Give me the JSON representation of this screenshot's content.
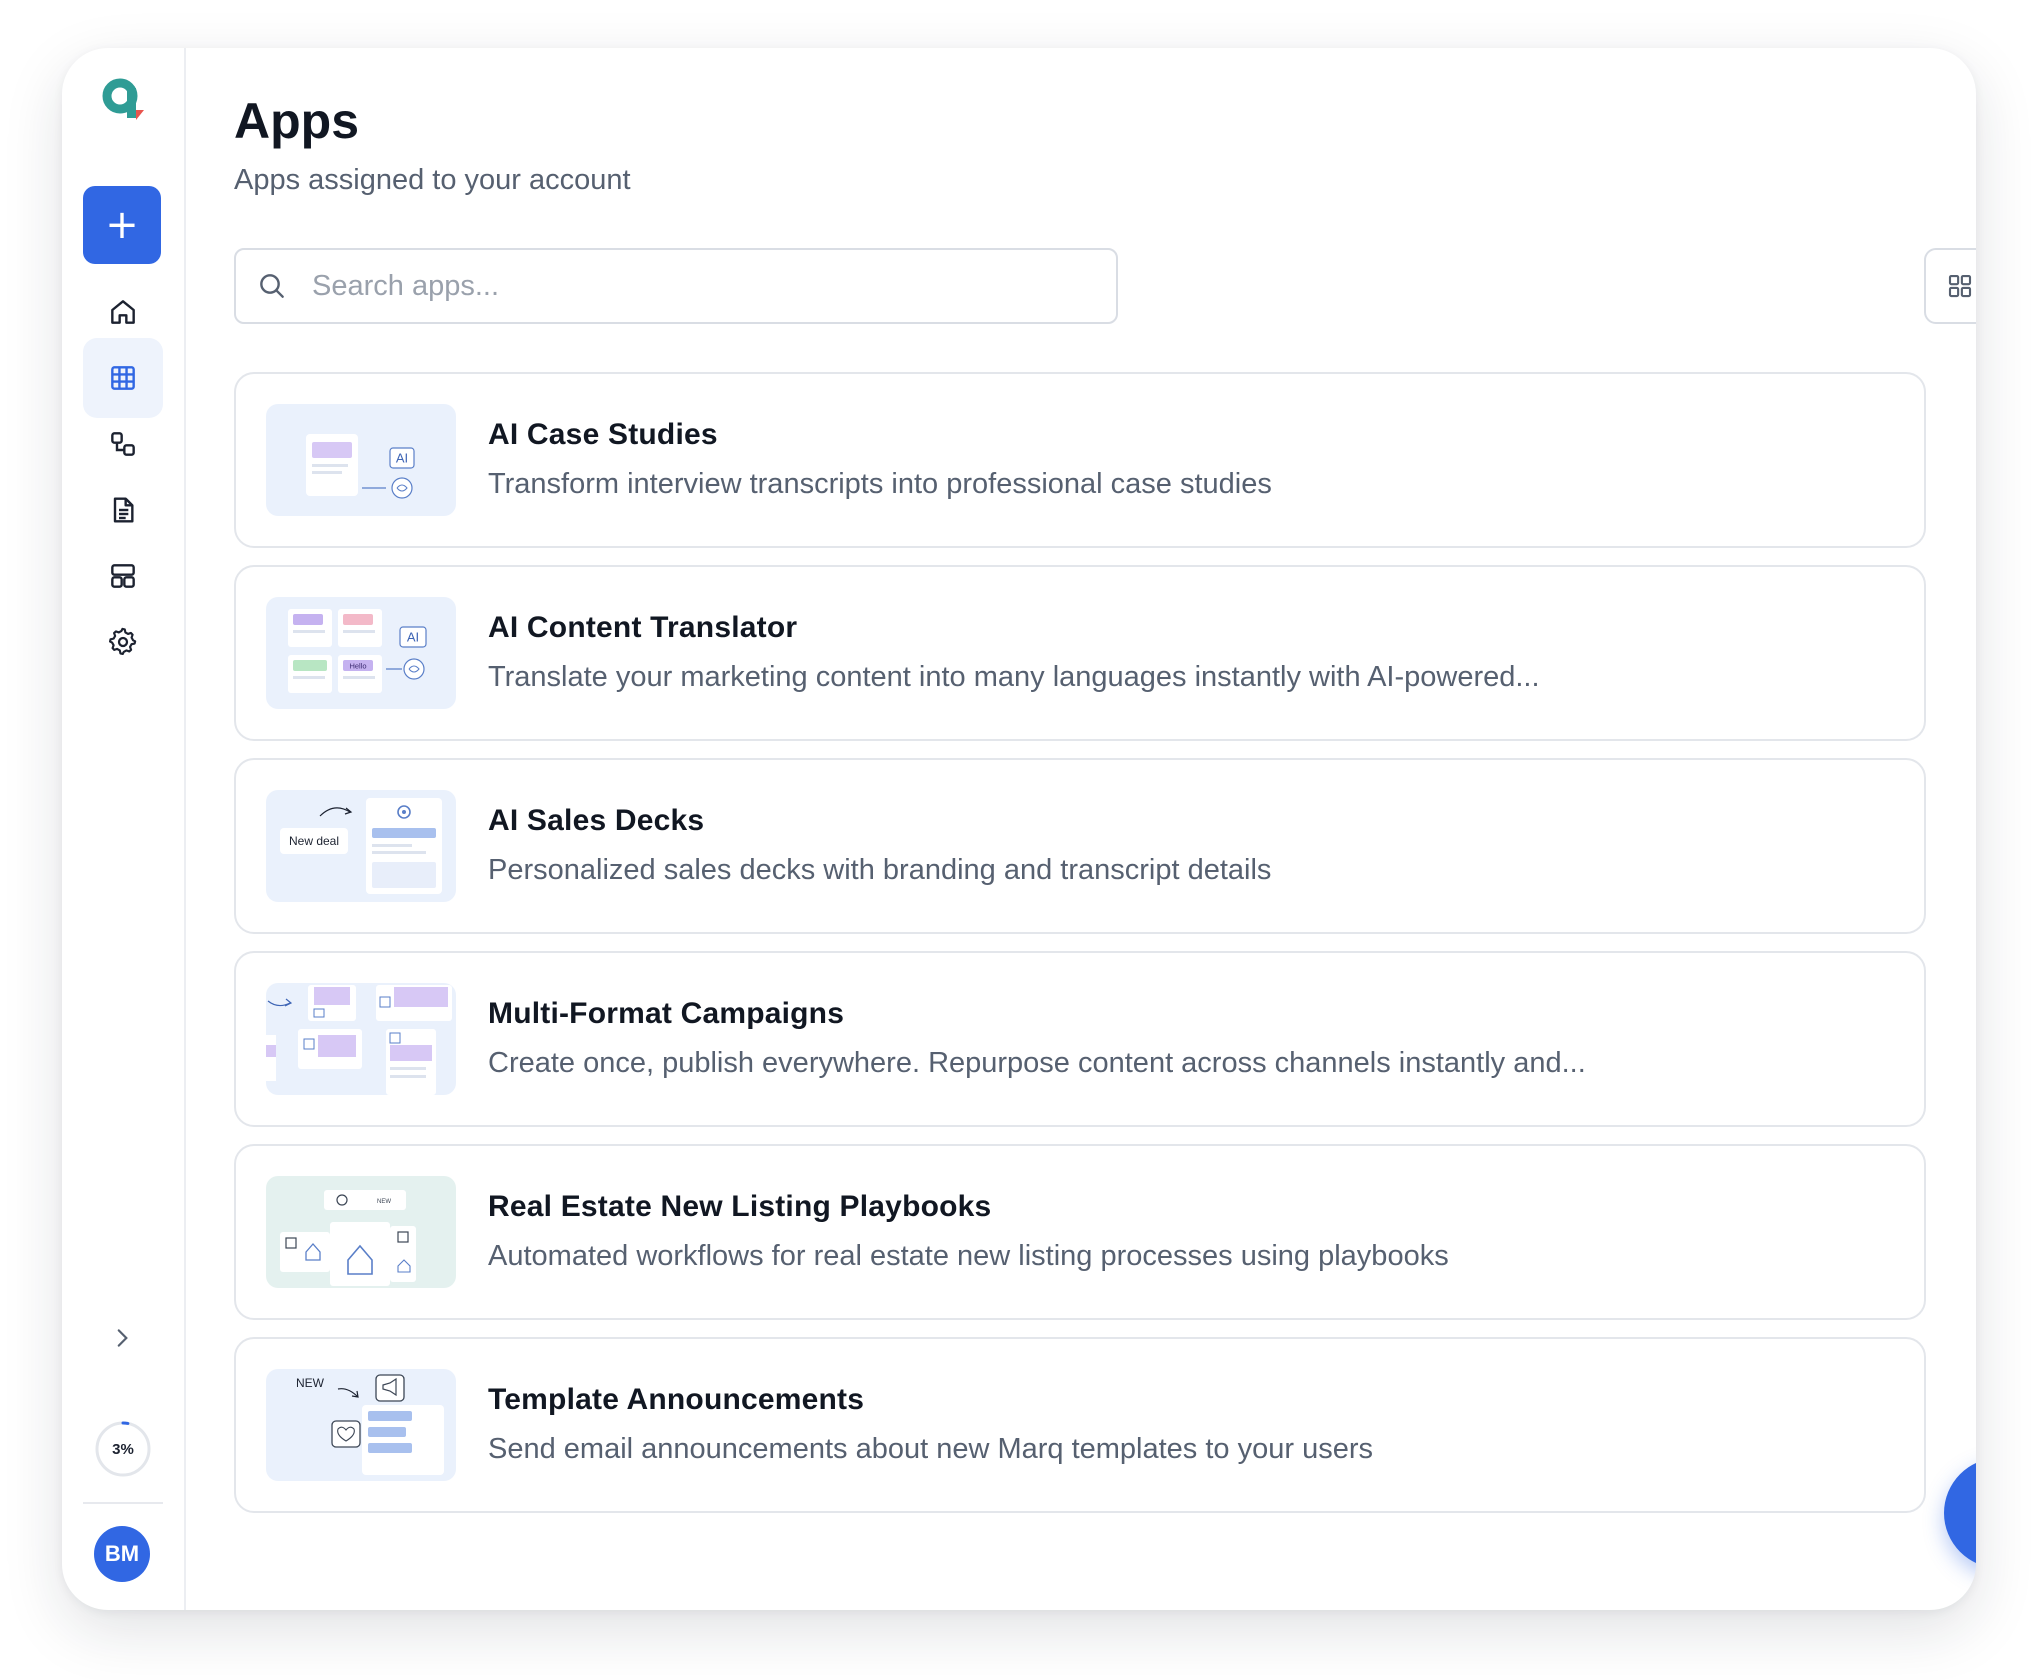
{
  "page": {
    "title": "Apps",
    "subtitle": "Apps assigned to your account"
  },
  "sidebar": {
    "create_label": "+",
    "items": [
      {
        "name": "home",
        "icon": "home-icon"
      },
      {
        "name": "apps",
        "icon": "grid-icon",
        "active": true
      },
      {
        "name": "workflows",
        "icon": "workflow-icon"
      },
      {
        "name": "documents",
        "icon": "document-icon"
      },
      {
        "name": "templates",
        "icon": "layout-icon"
      },
      {
        "name": "settings",
        "icon": "gear-icon"
      }
    ],
    "progress": {
      "label": "3%",
      "value": 0.03
    },
    "avatar_initials": "BM"
  },
  "search": {
    "placeholder": "Search apps..."
  },
  "view_toggle": {
    "options": [
      "grid",
      "list"
    ],
    "selected": "list"
  },
  "apps": [
    {
      "title": "AI Case Studies",
      "description": "Transform interview transcripts into professional case studies",
      "thumbnail": "ai-case-studies",
      "thumb_text": [
        "AI"
      ]
    },
    {
      "title": "AI Content Translator",
      "description": "Translate your marketing content into many languages instantly with AI-powered...",
      "thumbnail": "ai-content-translator",
      "thumb_text": [
        "AI",
        "Hello"
      ]
    },
    {
      "title": "AI Sales Decks",
      "description": "Personalized sales decks with branding and transcript details",
      "thumbnail": "ai-sales-decks",
      "thumb_text": [
        "New deal"
      ]
    },
    {
      "title": "Multi-Format Campaigns",
      "description": "Create once, publish everywhere. Repurpose content across channels instantly and...",
      "thumbnail": "multi-format-campaigns",
      "thumb_text": []
    },
    {
      "title": "Real Estate New Listing Playbooks",
      "description": "Automated workflows for real estate new listing processes using playbooks",
      "thumbnail": "real-estate-playbooks",
      "thumb_text": [
        "NEW"
      ]
    },
    {
      "title": "Template Announcements",
      "description": "Send email announcements about new Marq templates to your users",
      "thumbnail": "template-announcements",
      "thumb_text": [
        "NEW"
      ]
    }
  ],
  "colors": {
    "primary": "#3167e3",
    "active_nav_bg": "#eef3fc",
    "border": "#e3e6eb",
    "text_primary": "#111722",
    "text_secondary": "#566070",
    "logo_teal": "#2f9c95",
    "logo_red": "#e8554e"
  }
}
